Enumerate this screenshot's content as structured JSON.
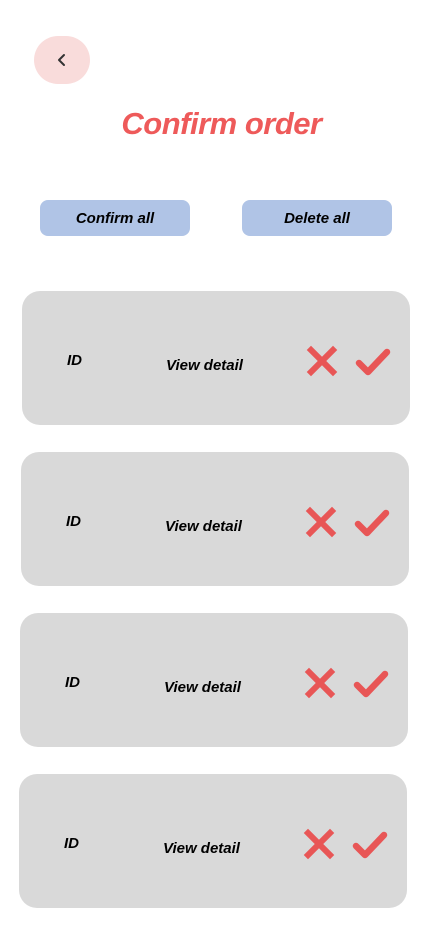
{
  "header": {
    "back_icon": "chevron-left-icon",
    "title": "Confirm order"
  },
  "actions": {
    "confirm_all_label": "Confirm all",
    "delete_all_label": "Delete all"
  },
  "colors": {
    "accent": "#ee5a5a",
    "back_button_bg": "#f9dcdb",
    "action_button_bg": "#b0c4e6",
    "card_bg": "#d9d9d9"
  },
  "orders": [
    {
      "id_label": "ID",
      "detail_label": "View detail",
      "reject_icon": "close-icon",
      "accept_icon": "check-icon"
    },
    {
      "id_label": "ID",
      "detail_label": "View detail",
      "reject_icon": "close-icon",
      "accept_icon": "check-icon"
    },
    {
      "id_label": "ID",
      "detail_label": "View detail",
      "reject_icon": "close-icon",
      "accept_icon": "check-icon"
    },
    {
      "id_label": "ID",
      "detail_label": "View detail",
      "reject_icon": "close-icon",
      "accept_icon": "check-icon"
    }
  ]
}
